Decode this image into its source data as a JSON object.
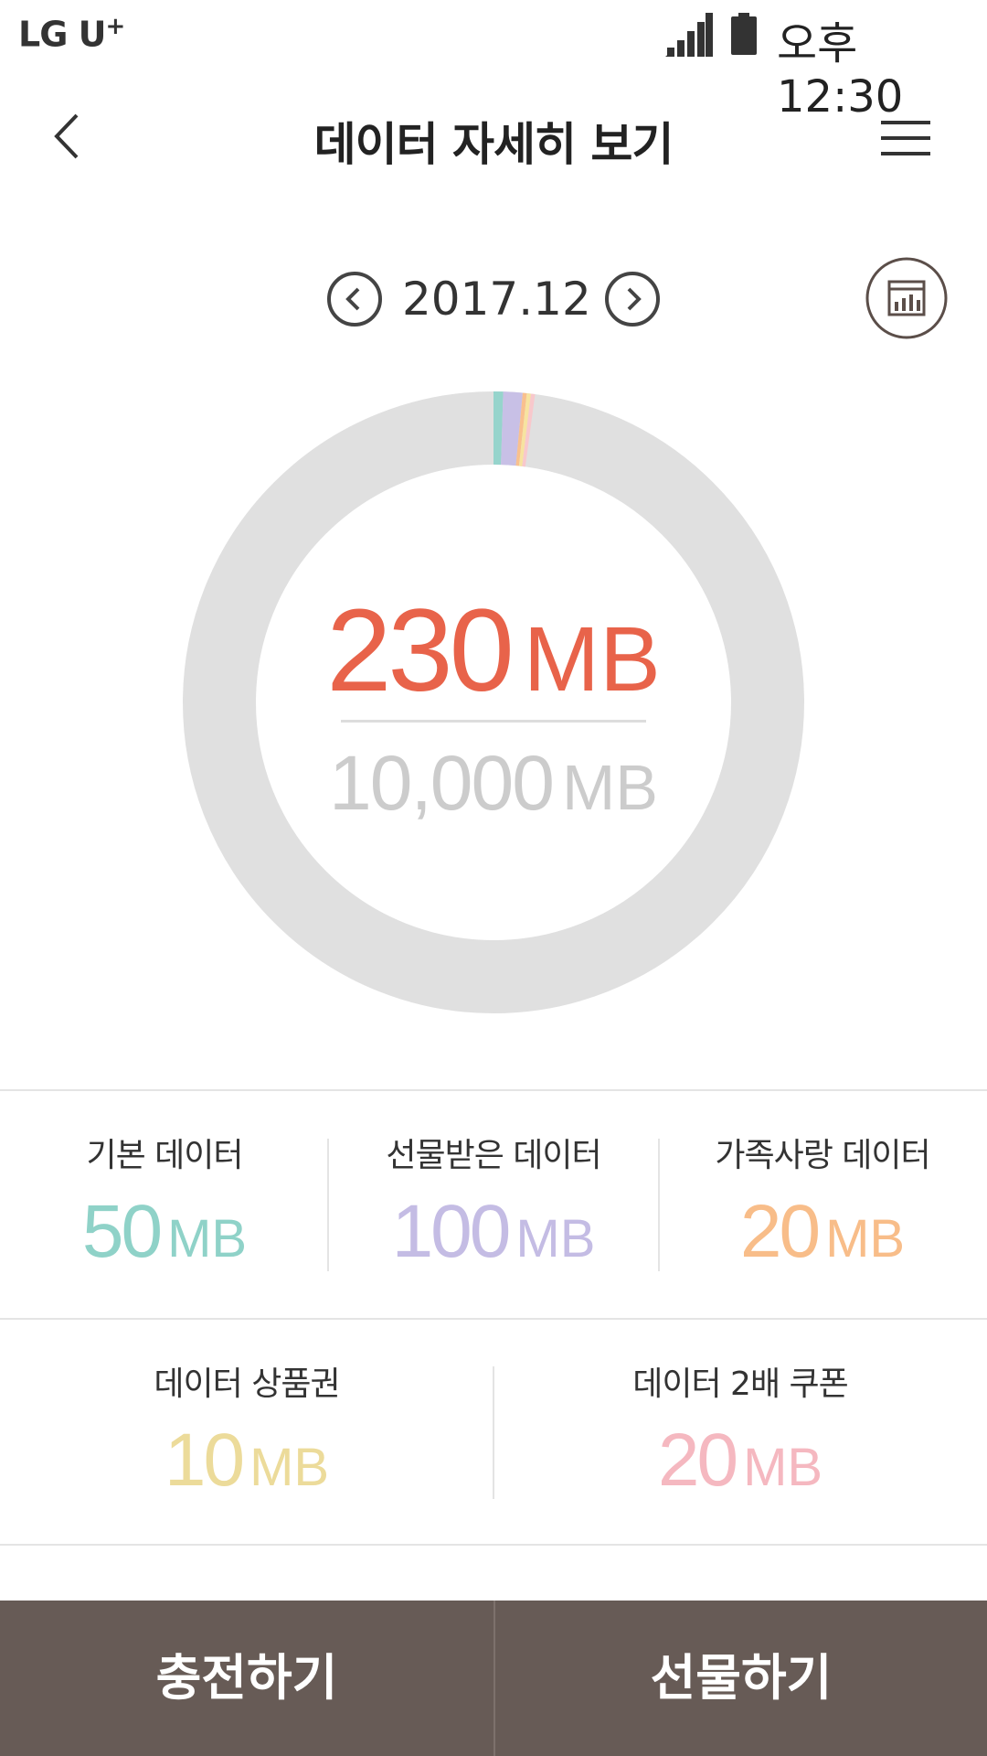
{
  "status_bar": {
    "carrier": "LG U",
    "carrier_mark": "+",
    "time": "오후 12:30"
  },
  "header": {
    "title": "데이터 자세히 보기",
    "back_icon": "chevron-left-icon",
    "menu_icon": "hamburger-menu-icon"
  },
  "period": {
    "label": "2017.12",
    "prev_icon": "circle-chevron-left-icon",
    "next_icon": "circle-chevron-right-icon",
    "chart_icon": "bar-chart-icon"
  },
  "usage": {
    "used_value": "230",
    "used_unit": "MB",
    "total_value": "10,000",
    "total_unit": "MB"
  },
  "chart_data": {
    "type": "pie",
    "total": 10000,
    "remainder_color": "#e0e0e0",
    "segments": [
      {
        "label": "기본 데이터",
        "value": 50,
        "color": "#96d4cc"
      },
      {
        "label": "선물받은 데이터",
        "value": 100,
        "color": "#c8c0e6"
      },
      {
        "label": "가족사랑 데이터",
        "value": 20,
        "color": "#f9c08e"
      },
      {
        "label": "데이터 상품권",
        "value": 10,
        "color": "#f7e3a0"
      },
      {
        "label": "데이터 2배 쿠폰",
        "value": 20,
        "color": "#f8c8cc"
      }
    ]
  },
  "stats": [
    {
      "label": "기본 데이터",
      "value": "50",
      "unit": "MB",
      "color": "#8fd2c8"
    },
    {
      "label": "선물받은 데이터",
      "value": "100",
      "unit": "MB",
      "color": "#c4bce4"
    },
    {
      "label": "가족사랑 데이터",
      "value": "20",
      "unit": "MB",
      "color": "#f8bd89"
    },
    {
      "label": "데이터 상품권",
      "value": "10",
      "unit": "MB",
      "color": "#ecdb9a"
    },
    {
      "label": "데이터 2배 쿠폰",
      "value": "20",
      "unit": "MB",
      "color": "#f5b8c0"
    }
  ],
  "actions": {
    "charge_label": "충전하기",
    "gift_label": "선물하기"
  },
  "colors": {
    "accent": "#e8634a",
    "bottom_bar": "#675b56"
  }
}
